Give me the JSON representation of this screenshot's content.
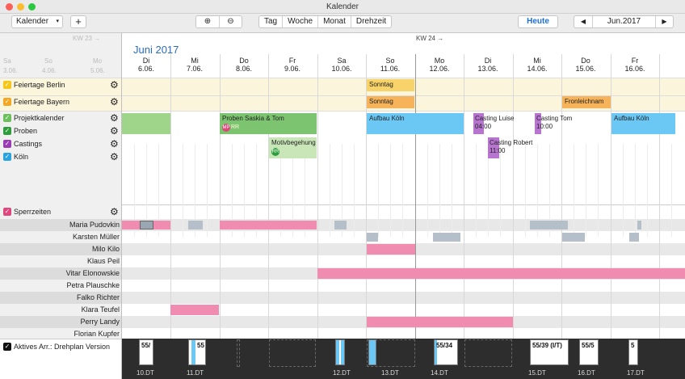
{
  "app": {
    "title": "Kalender"
  },
  "toolbar": {
    "calendar_select": "Kalender",
    "add_label": "+",
    "zoom_in_icon": "zoom-in-icon",
    "zoom_out_icon": "zoom-out-icon",
    "views": [
      "Tag",
      "Woche",
      "Monat",
      "Drehzeit"
    ],
    "today_label": "Heute",
    "prev_label": "◀",
    "period": "Jun.2017",
    "next_label": "▶"
  },
  "header": {
    "kw_label": "KW 24 →",
    "month": "Juni 2017",
    "ghost_kw": "KW 23 →",
    "ghost_days": [
      "Sa",
      "So",
      "Mo"
    ],
    "ghost_dates": [
      "3.06.",
      "4.06.",
      "5.06."
    ]
  },
  "days": [
    {
      "dow": "Di",
      "date": "6.06."
    },
    {
      "dow": "Mi",
      "date": "7.06."
    },
    {
      "dow": "Do",
      "date": "8.06."
    },
    {
      "dow": "Fr",
      "date": "9.06."
    },
    {
      "dow": "Sa",
      "date": "10.06."
    },
    {
      "dow": "So",
      "date": "11.06."
    },
    {
      "dow": "Mo",
      "date": "12.06."
    },
    {
      "dow": "Di",
      "date": "13.06."
    },
    {
      "dow": "Mi",
      "date": "14.06."
    },
    {
      "dow": "Do",
      "date": "15.06."
    },
    {
      "dow": "Fr",
      "date": "16.06."
    }
  ],
  "calendars": [
    {
      "label": "Feiertage Berlin",
      "color": "#f5c518"
    },
    {
      "label": "Feiertage Bayern",
      "color": "#f5a623"
    },
    {
      "label": "Projektkalender",
      "color": "#6cc05a"
    },
    {
      "label": "Proben",
      "color": "#2e9e3c"
    },
    {
      "label": "Castings",
      "color": "#9b3ab5"
    },
    {
      "label": "Köln",
      "color": "#2aa4e0"
    },
    {
      "label": "Sperrzeiten",
      "color": "#e0457b"
    }
  ],
  "people": [
    "Maria Pudovkin",
    "Karsten Müller",
    "Milo Kilo",
    "Klaus Peil",
    "Vitar Elonowskie",
    "Petra Plauschke",
    "Falko Richter",
    "Klara Teufel",
    "Perry Landy",
    "Florian Kupfer"
  ],
  "events": {
    "sonntag_berlin": "Sonntag",
    "sonntag_bayern": "Sonntag",
    "fronleichnam": "Fronleichnam",
    "proben_title": "Proben Saskia & Tom",
    "badge_mp": "MP",
    "badge_rr": "RR",
    "motiv_title": "Motivbegehung Turm",
    "motiv_badge": "RR",
    "aufbau1": "Aufbau Köln",
    "aufbau2": "Aufbau Köln",
    "casting_luise": "Casting Luise",
    "casting_luise_time": "04:00",
    "casting_tom": "Casting Tom",
    "casting_tom_time": "10:00",
    "casting_robert": "Casting Robert",
    "casting_robert_time": "11:00"
  },
  "footer": {
    "active_label": "Aktives Arr.: Drehplan Version"
  },
  "timeline": {
    "boxes": [
      "55/",
      "55",
      "55/34",
      "55/39 (I/T)",
      "55/5",
      "5"
    ],
    "labels": [
      "10.DT",
      "11.DT",
      "12.DT",
      "13.DT",
      "14.DT",
      "15.DT",
      "16.DT",
      "17.DT"
    ]
  }
}
